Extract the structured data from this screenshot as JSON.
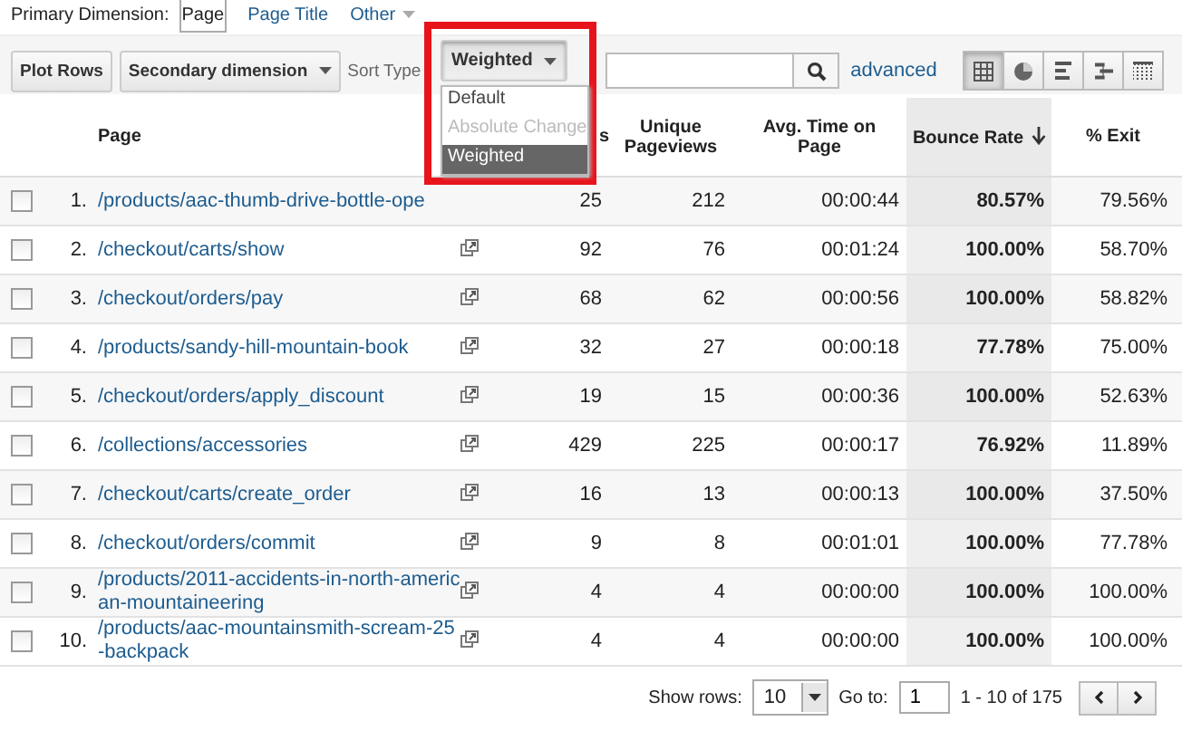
{
  "primary_dimension": {
    "label": "Primary Dimension:",
    "options": [
      {
        "label": "Page",
        "selected": true,
        "kind": "plain"
      },
      {
        "label": "Page Title",
        "selected": false,
        "kind": "plain"
      },
      {
        "label": "Other",
        "selected": false,
        "kind": "menu"
      }
    ]
  },
  "toolbar": {
    "plot_rows": "Plot Rows",
    "secondary_dimension": "Secondary dimension",
    "sort_type_label": "Sort Type",
    "sort_dropdown": {
      "value": "Weighted",
      "expanded": true,
      "highlighted": true,
      "options": [
        {
          "label": "Default",
          "disabled": false,
          "selected": false
        },
        {
          "label": "Absolute Change",
          "disabled": true,
          "selected": false
        },
        {
          "label": "Weighted",
          "disabled": false,
          "selected": true
        }
      ]
    },
    "advanced": "advanced",
    "views": [
      {
        "kind": "table",
        "selected": true
      },
      {
        "kind": "pie",
        "selected": false
      },
      {
        "kind": "bar",
        "selected": false
      },
      {
        "kind": "comparison",
        "selected": false
      },
      {
        "kind": "pivot",
        "selected": false
      }
    ]
  },
  "table": {
    "columns": [
      {
        "label": "Page",
        "sorted": false
      },
      {
        "label": "s",
        "sorted": false
      },
      {
        "label": "Unique Pageviews",
        "sorted": false
      },
      {
        "label": "Avg. Time on Page",
        "sorted": false
      },
      {
        "label": "Bounce Rate",
        "sorted": true
      },
      {
        "label": "% Exit",
        "sorted": false
      }
    ],
    "rows": [
      {
        "index": "1.",
        "page": "/products/aac-thumb-drive-bottle-ope",
        "link_icon": false,
        "pageviews": "25",
        "unique": "212",
        "avg_time": "00:00:44",
        "bounce": "80.57%",
        "exit": "79.56%",
        "checked": false
      },
      {
        "index": "2.",
        "page": "/checkout/carts/show",
        "link_icon": true,
        "pageviews": "92",
        "unique": "76",
        "avg_time": "00:01:24",
        "bounce": "100.00%",
        "exit": "58.70%",
        "checked": false
      },
      {
        "index": "3.",
        "page": "/checkout/orders/pay",
        "link_icon": true,
        "pageviews": "68",
        "unique": "62",
        "avg_time": "00:00:56",
        "bounce": "100.00%",
        "exit": "58.82%",
        "checked": false
      },
      {
        "index": "4.",
        "page": "/products/sandy-hill-mountain-book",
        "link_icon": true,
        "pageviews": "32",
        "unique": "27",
        "avg_time": "00:00:18",
        "bounce": "77.78%",
        "exit": "75.00%",
        "checked": false
      },
      {
        "index": "5.",
        "page": "/checkout/orders/apply_discount",
        "link_icon": true,
        "pageviews": "19",
        "unique": "15",
        "avg_time": "00:00:36",
        "bounce": "100.00%",
        "exit": "52.63%",
        "checked": false
      },
      {
        "index": "6.",
        "page": "/collections/accessories",
        "link_icon": true,
        "pageviews": "429",
        "unique": "225",
        "avg_time": "00:00:17",
        "bounce": "76.92%",
        "exit": "11.89%",
        "checked": false
      },
      {
        "index": "7.",
        "page": "/checkout/carts/create_order",
        "link_icon": true,
        "pageviews": "16",
        "unique": "13",
        "avg_time": "00:00:13",
        "bounce": "100.00%",
        "exit": "37.50%",
        "checked": false
      },
      {
        "index": "8.",
        "page": "/checkout/orders/commit",
        "link_icon": true,
        "pageviews": "9",
        "unique": "8",
        "avg_time": "00:01:01",
        "bounce": "100.00%",
        "exit": "77.78%",
        "checked": false
      },
      {
        "index": "9.",
        "page": "/products/2011-accidents-in-north-american-mountaineering",
        "link_icon": true,
        "pageviews": "4",
        "unique": "4",
        "avg_time": "00:00:00",
        "bounce": "100.00%",
        "exit": "100.00%",
        "checked": false
      },
      {
        "index": "10.",
        "page": "/products/aac-mountainsmith-scream-25-backpack",
        "link_icon": true,
        "pageviews": "4",
        "unique": "4",
        "avg_time": "00:00:00",
        "bounce": "100.00%",
        "exit": "100.00%",
        "checked": false
      }
    ]
  },
  "footer": {
    "show_rows_label": "Show rows:",
    "show_rows_value": "10",
    "go_to_label": "Go to:",
    "go_to_value": "1",
    "range": "1 - 10 of 175"
  }
}
